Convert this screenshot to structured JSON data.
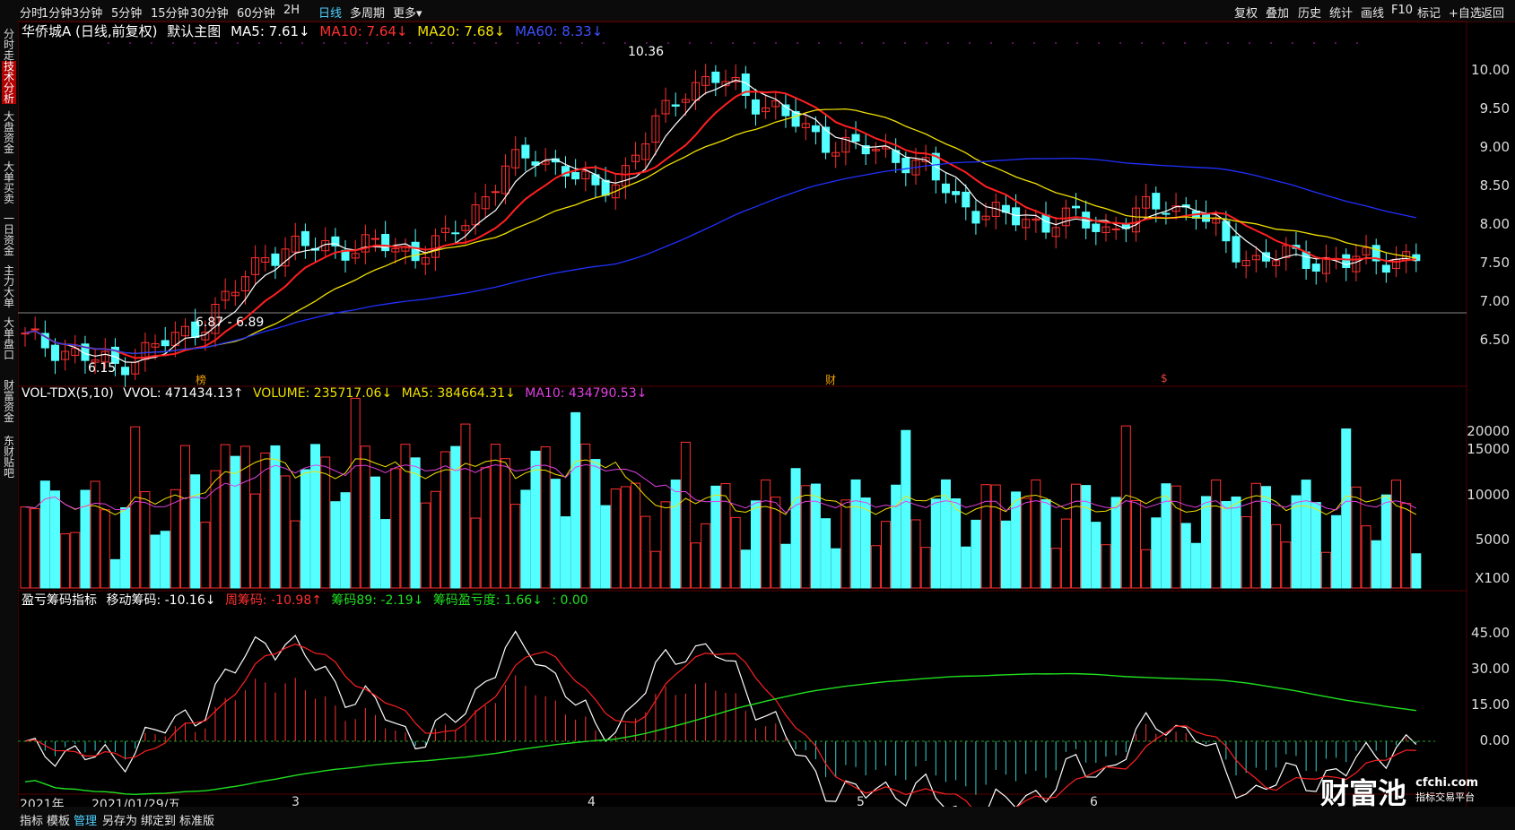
{
  "toolbar_left": [
    {
      "label": "分时",
      "active": false
    },
    {
      "label": "1分钟",
      "active": false
    },
    {
      "label": "3分钟",
      "active": false
    },
    {
      "label": "5分钟",
      "active": false
    },
    {
      "label": "15分钟",
      "active": false
    },
    {
      "label": "30分钟",
      "active": false
    },
    {
      "label": "60分钟",
      "active": false
    },
    {
      "label": "2H",
      "active": false
    },
    {
      "label": "日线",
      "active": true
    },
    {
      "label": "多周期",
      "active": false
    },
    {
      "label": "更多▾",
      "active": false
    }
  ],
  "toolbar_right": [
    "复权",
    "叠加",
    "历史",
    "统计",
    "画线",
    "F10",
    "标记",
    "+自选",
    "返回"
  ],
  "sidebar": [
    {
      "label": "分时走势",
      "active": false
    },
    {
      "label": "技术分析",
      "active": true
    },
    {
      "label": "大盘资金",
      "active": false
    },
    {
      "label": "大单买卖",
      "active": false
    },
    {
      "label": "一日资金",
      "active": false
    },
    {
      "label": "主力大单",
      "active": false
    },
    {
      "label": "大单盘口",
      "active": false
    },
    {
      "label": "财富资金",
      "active": false
    },
    {
      "label": "东财贴吧",
      "active": false
    }
  ],
  "main_header": {
    "stock": "华侨城A (日线,前复权)",
    "template": "默认主图",
    "ma5": "MA5: 7.61↓",
    "ma10": "MA10: 7.64↓",
    "ma20": "MA20: 7.68↓",
    "ma60": "MA60: 8.33↓"
  },
  "vol_header": {
    "name": "VOL-TDX(5,10)",
    "vvol": "VVOL: 471434.13↑",
    "volume": "VOLUME: 235717.06↓",
    "ma5": "MA5: 384664.31↓",
    "ma10": "MA10: 434790.53↓"
  },
  "ind_header": {
    "name": "盈亏筹码指标",
    "move": "移动筹码: -10.16↓",
    "week": "周筹码: -10.98↑",
    "c89": "筹码89: -2.19↓",
    "pl": "筹码盈亏度: 1.66↓",
    "zero": ": 0.00"
  },
  "price_axis": [
    "10.00",
    "9.50",
    "9.00",
    "8.50",
    "8.00",
    "7.50",
    "7.00",
    "6.50"
  ],
  "vol_axis": [
    "20000",
    "15000",
    "10000",
    "5000",
    "X100"
  ],
  "ind_axis": [
    "45.00",
    "30.00",
    "15.00",
    "0.00"
  ],
  "annotations": {
    "high": "10.36",
    "low": "6.15",
    "mid": "6.87 - 6.89",
    "mark_a": "榜",
    "mark_b": "财",
    "mark_c": "$"
  },
  "x_axis": [
    "2021年",
    "2021/01/29/五",
    "3",
    "4",
    "5",
    "6"
  ],
  "bottombar": [
    {
      "label": "指标",
      "active": false
    },
    {
      "label": "模板",
      "active": false
    },
    {
      "label": "管理",
      "active": true
    },
    {
      "label": "另存为",
      "active": false
    },
    {
      "label": "绑定到",
      "active": false
    },
    {
      "label": "标准版",
      "active": false
    }
  ],
  "logo": {
    "brand": "财富池",
    "site": "cfchi.com",
    "tagline": "指标交易平台"
  },
  "chart_data": {
    "type": "candlestick",
    "title": "华侨城A (日线,前复权)",
    "ylim": [
      6.15,
      10.36
    ],
    "x_range": "2021-01 to 2021-06",
    "close_trend": [
      6.55,
      6.45,
      6.3,
      6.2,
      6.4,
      6.55,
      6.8,
      7.2,
      7.7,
      7.75,
      7.8,
      7.75,
      7.8,
      7.7,
      7.85,
      8.3,
      8.8,
      9.0,
      8.8,
      8.5,
      8.8,
      9.4,
      9.9,
      10.0,
      9.8,
      9.6,
      9.3,
      9.15,
      9.05,
      9.0,
      8.8,
      8.4,
      8.2,
      8.15,
      8.1,
      8.15,
      8.0,
      8.2,
      8.35,
      8.25,
      7.8,
      7.6,
      7.65,
      7.6,
      7.55,
      7.65,
      7.6
    ],
    "colors": {
      "up": "#ff3030",
      "down": "#54ffff",
      "ma5": "#ffffff",
      "ma10": "#ff2020",
      "ma20": "#f0e000",
      "ma60": "#2030ff"
    }
  }
}
